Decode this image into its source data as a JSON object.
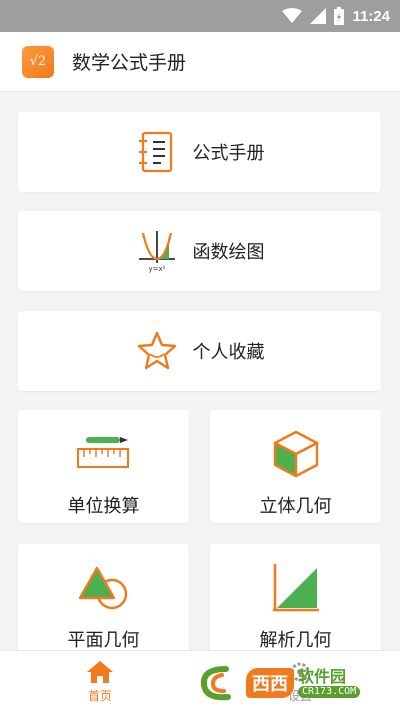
{
  "status_bar": {
    "time": "11:24"
  },
  "app_bar": {
    "logo_text": "√2",
    "title": "数学公式手册"
  },
  "menu": {
    "formula_manual": {
      "label": "公式手册",
      "icon": "notebook-icon"
    },
    "function_plot": {
      "label": "函数绘图",
      "icon": "function-graph-icon",
      "icon_caption": "y=x²"
    },
    "favorites": {
      "label": "个人收藏",
      "icon": "star-icon"
    },
    "unit_conversion": {
      "label": "单位换算",
      "icon": "ruler-pencil-icon"
    },
    "solid_geometry": {
      "label": "立体几何",
      "icon": "cube-icon"
    },
    "plane_geometry": {
      "label": "平面几何",
      "icon": "triangle-circle-icon"
    },
    "analytic_geometry": {
      "label": "解析几何",
      "icon": "axes-triangle-icon"
    }
  },
  "bottom_nav": {
    "home": {
      "label": "首页",
      "icon": "home-icon",
      "active": true
    },
    "settings": {
      "label": "设置",
      "icon": "gear-icon",
      "active": false
    }
  },
  "watermark": {
    "brand": "西西",
    "name": "软件园",
    "domain": "CR173.COM"
  },
  "colors": {
    "accent": "#f07a1c",
    "green": "#4caf50",
    "background": "#f3f3f3",
    "status_bar": "#9e9e9e"
  }
}
